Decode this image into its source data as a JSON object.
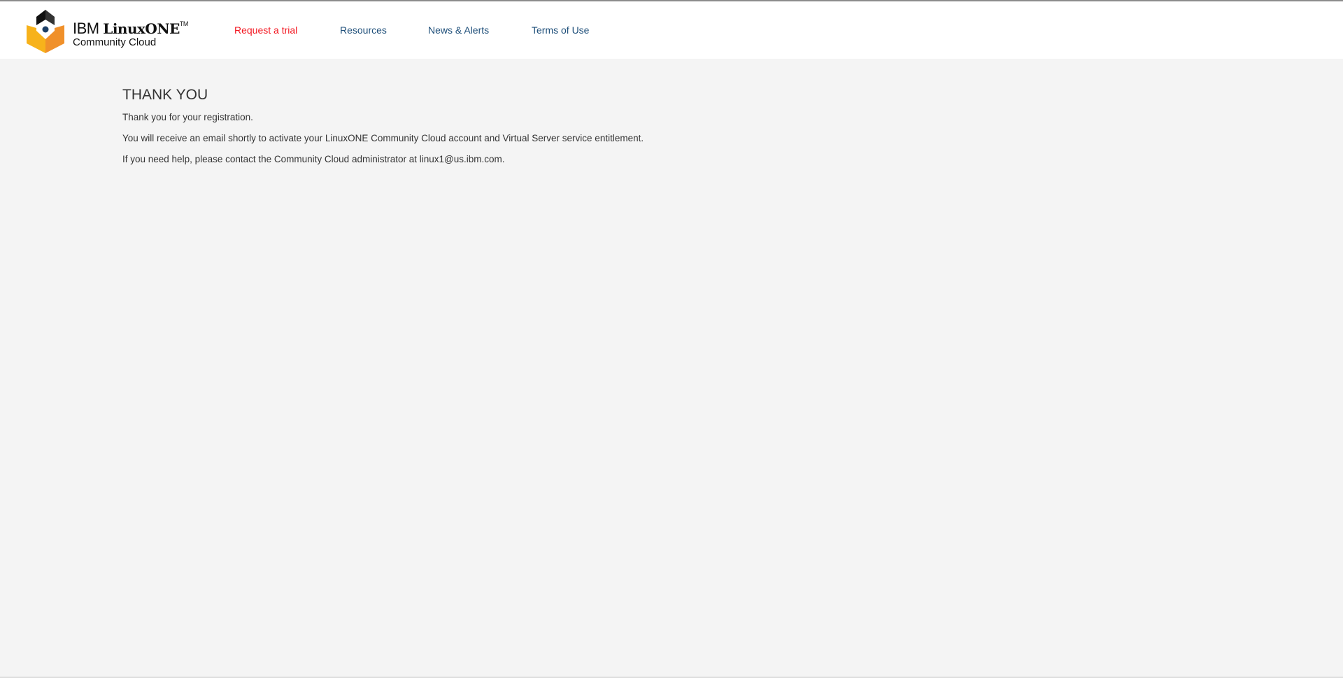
{
  "header": {
    "logo": {
      "line1_light": "IBM",
      "line1_bold": "LinuxONE",
      "tm": "TM",
      "line2": "Community Cloud"
    },
    "nav": [
      {
        "label": "Request a trial",
        "active": true
      },
      {
        "label": "Resources"
      },
      {
        "label": "News & Alerts"
      },
      {
        "label": "Terms of Use"
      }
    ]
  },
  "main": {
    "title": "THANK YOU",
    "paragraphs": [
      "Thank you for your registration.",
      "You will receive an email shortly to activate your LinuxONE Community Cloud account and Virtual Server service entitlement.",
      "If you need help, please contact the Community Cloud administrator at linux1@us.ibm.com."
    ]
  },
  "colors": {
    "active_nav": "#f3151f",
    "nav": "#1d4e79",
    "background": "#f4f4f4"
  }
}
